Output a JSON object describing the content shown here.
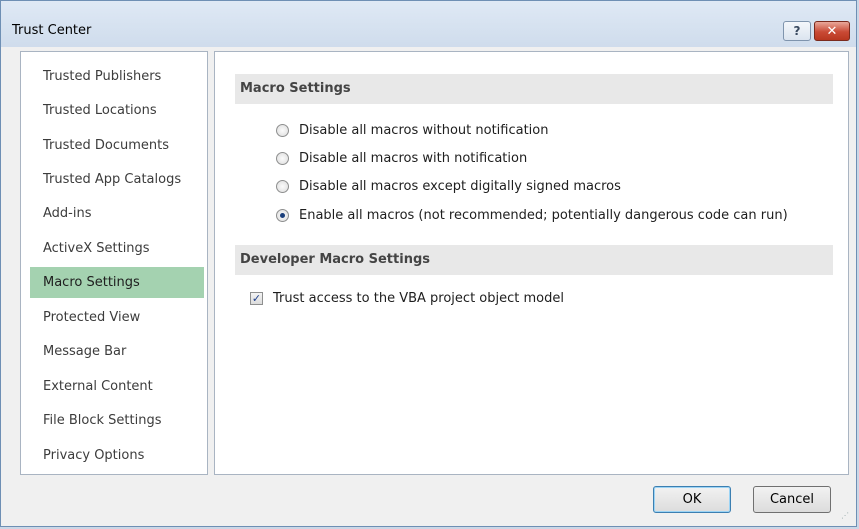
{
  "window": {
    "title": "Trust Center",
    "help_symbol": "?",
    "close_symbol": "✕"
  },
  "nav": {
    "items": [
      {
        "label": "Trusted Publishers"
      },
      {
        "label": "Trusted Locations"
      },
      {
        "label": "Trusted Documents"
      },
      {
        "label": "Trusted App Catalogs"
      },
      {
        "label": "Add-ins"
      },
      {
        "label": "ActiveX Settings"
      },
      {
        "label": "Macro Settings",
        "selected": true
      },
      {
        "label": "Protected View"
      },
      {
        "label": "Message Bar"
      },
      {
        "label": "External Content"
      },
      {
        "label": "File Block Settings"
      },
      {
        "label": "Privacy Options"
      }
    ],
    "selected_color": "#a4d2b0"
  },
  "macro_settings": {
    "header": "Macro Settings",
    "options": [
      {
        "label": "Disable all macros without notification",
        "checked": false
      },
      {
        "label": "Disable all macros with notification",
        "checked": false
      },
      {
        "label": "Disable all macros except digitally signed macros",
        "checked": false
      },
      {
        "label": "Enable all macros (not recommended; potentially dangerous code can run)",
        "checked": true
      }
    ]
  },
  "developer_settings": {
    "header": "Developer Macro Settings",
    "vba_access_label": "Trust access to the VBA project object model",
    "vba_access_checked": true,
    "check_symbol": "✓"
  },
  "buttons": {
    "ok": "OK",
    "cancel": "Cancel"
  }
}
